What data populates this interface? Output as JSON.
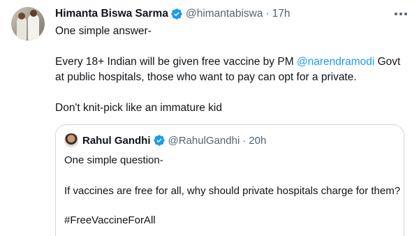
{
  "tweet": {
    "author_name": "Himanta Biswa Sarma",
    "author_handle": "@himantabiswa",
    "separator": "·",
    "time": "17h",
    "line1": "One simple answer-",
    "line2_before": "Every 18+ Indian will be given free vaccine by PM ",
    "line2_mention": "@narendramodi",
    "line2_after": " Govt at public  hospitals, those who want to pay can opt for a private.",
    "line3": "Don't knit-pick like an immature kid"
  },
  "quoted_tweet": {
    "author_name": "Rahul Gandhi",
    "author_handle": "@RahulGandhi",
    "separator": "·",
    "time": "20h",
    "line1": "One simple question-",
    "line2": "If vaccines are free for all, why should private hospitals charge for them?",
    "line3": "#FreeVaccineForAll"
  },
  "icons": {
    "verified": "verified-badge-icon",
    "more": "more-options-icon"
  },
  "colors": {
    "text_primary": "#0f1419",
    "text_secondary": "#536471",
    "link": "#1d9bf0",
    "border": "#cfd9de",
    "verified": "#1d9bf0"
  }
}
